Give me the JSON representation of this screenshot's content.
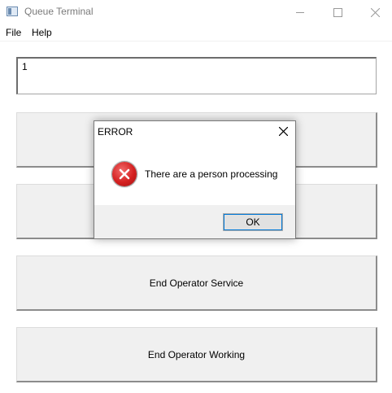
{
  "window": {
    "title": "Queue Terminal"
  },
  "menu": {
    "items": [
      "File",
      "Help"
    ]
  },
  "input": {
    "value": "1"
  },
  "buttons": {
    "btn1": "",
    "btn2": "",
    "btn3": "End Operator Service",
    "btn4": "End Operator Working"
  },
  "dialog": {
    "title": "ERROR",
    "message": "There are a person processing",
    "ok_label": "OK",
    "icon": "error-icon"
  },
  "colors": {
    "error_red": "#d42020",
    "focus_blue": "#0078d7"
  }
}
